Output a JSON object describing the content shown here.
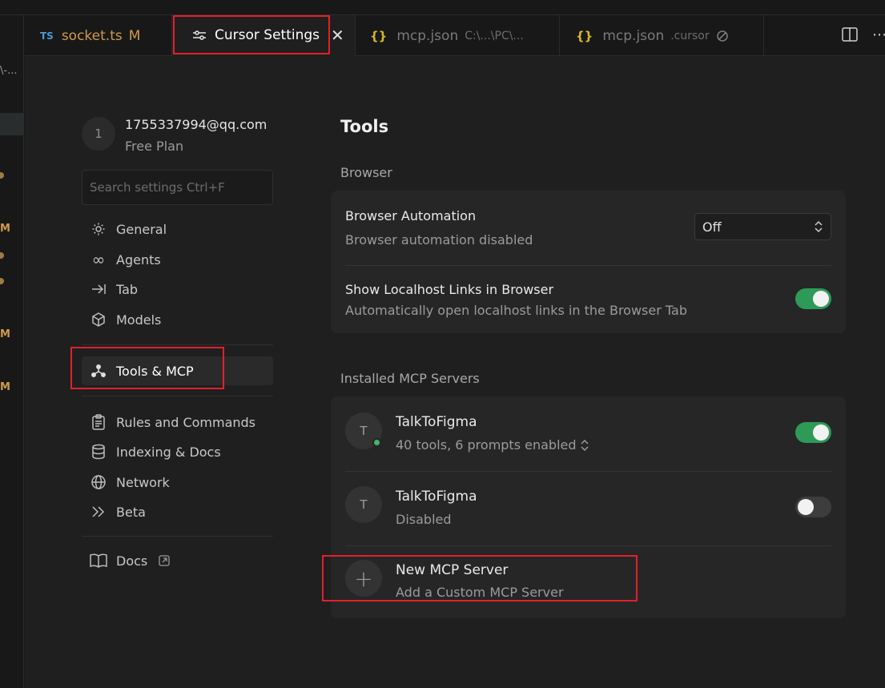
{
  "gutter": {
    "markers": [
      "\\-...",
      "M",
      "M",
      "M"
    ]
  },
  "tabs": [
    {
      "badge": "TS",
      "label": "socket.ts",
      "flag": "M"
    },
    {
      "label": "Cursor Settings",
      "close": "✕"
    },
    {
      "badge": "{}",
      "label": "mcp.json",
      "path": "C:\\...\\PC\\..."
    },
    {
      "badge": "{}",
      "label": "mcp.json",
      "path": ".cursor"
    }
  ],
  "account": {
    "avatar_letter": "1",
    "email": "1755337994@qq.com",
    "plan": "Free Plan"
  },
  "search": {
    "placeholder": "Search settings Ctrl+F"
  },
  "nav": {
    "general": "General",
    "agents": "Agents",
    "tab": "Tab",
    "models": "Models",
    "tools": "Tools & MCP",
    "rules": "Rules and Commands",
    "indexing": "Indexing & Docs",
    "network": "Network",
    "beta": "Beta",
    "docs": "Docs"
  },
  "main": {
    "title": "Tools",
    "browser_section": "Browser",
    "browser_automation": {
      "title": "Browser Automation",
      "subtitle": "Browser automation disabled",
      "select_value": "Off"
    },
    "localhost": {
      "title": "Show Localhost Links in Browser",
      "subtitle": "Automatically open localhost links in the Browser Tab",
      "enabled": true
    },
    "mcp_section": "Installed MCP Servers",
    "servers": [
      {
        "letter": "T",
        "name": "TalkToFigma",
        "status": "40 tools, 6 prompts enabled",
        "enabled": true
      },
      {
        "letter": "T",
        "name": "TalkToFigma",
        "status": "Disabled",
        "enabled": false
      }
    ],
    "new_server": {
      "title": "New MCP Server",
      "subtitle": "Add a Custom MCP Server"
    }
  },
  "colors": {
    "accent_toggle": "#2e9a58",
    "highlight_box": "#e3202a",
    "modified": "#d19a4a"
  }
}
